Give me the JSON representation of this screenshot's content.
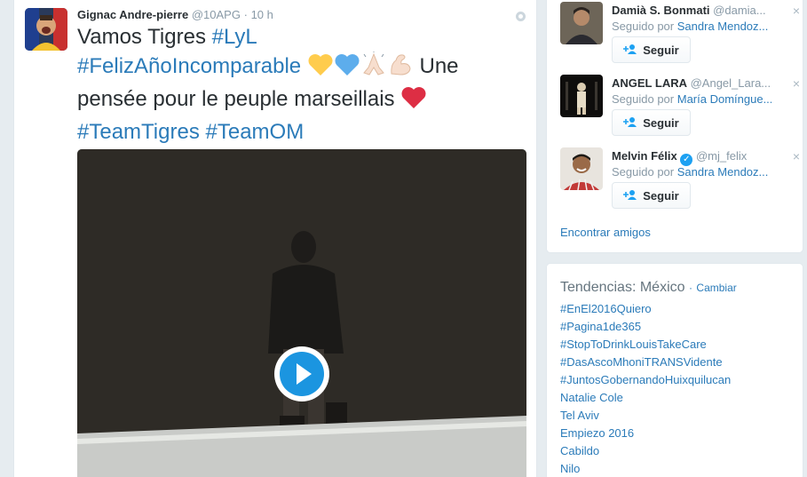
{
  "tweet": {
    "fullname": "Gignac Andre-pierre",
    "username": "@10APG",
    "separator": "·",
    "time": "10 h",
    "text": {
      "w1": "Vamos Tigres",
      "ht1": "#LyL",
      "ht2": "#FelizAñoIncomparable",
      "w2": "Une pensée pour le peuple marseillais",
      "ht3": "#TeamTigres",
      "ht4": "#TeamOM"
    },
    "emoji": {
      "yellow_heart": "💛",
      "blue_heart": "💙",
      "pray": "🙏",
      "muscle": "💪",
      "red_heart": "❤️"
    },
    "media": {
      "type": "video",
      "play_icon": "play-icon"
    }
  },
  "who_to_follow": {
    "users": [
      {
        "name": "Damià S. Bonmati",
        "handle": "@damia...",
        "followed_by_prefix": "Seguido por",
        "followed_by": "Sandra Mendoz...",
        "follow_label": "Seguir",
        "dismiss": "×"
      },
      {
        "name": "ANGEL LARA",
        "handle": "@Angel_Lara...",
        "followed_by_prefix": "Seguido por",
        "followed_by": "María Domíngue...",
        "follow_label": "Seguir",
        "dismiss": "×"
      },
      {
        "name": "Melvin Félix",
        "handle": "@mj_felix",
        "verified": true,
        "followed_by_prefix": "Seguido por",
        "followed_by": "Sandra Mendoz...",
        "follow_label": "Seguir",
        "dismiss": "×"
      }
    ],
    "find_friends": "Encontrar amigos"
  },
  "trends": {
    "title": "Tendencias: México",
    "dot": "·",
    "change": "Cambiar",
    "items": [
      "#EnEl2016Quiero",
      "#Pagina1de365",
      "#StopToDrinkLouisTakeCare",
      "#DasAscoMhoniTRANSVidente",
      "#JuntosGobernandoHuixquilucan",
      "Natalie Cole",
      "Tel Aviv",
      "Empiezo 2016",
      "Cabildo",
      "Nilo"
    ]
  },
  "colors": {
    "link": "#2b7bb9",
    "accent": "#1da1f2",
    "background": "#e6ecf0",
    "text": "#292f33",
    "muted": "#8899a6"
  }
}
